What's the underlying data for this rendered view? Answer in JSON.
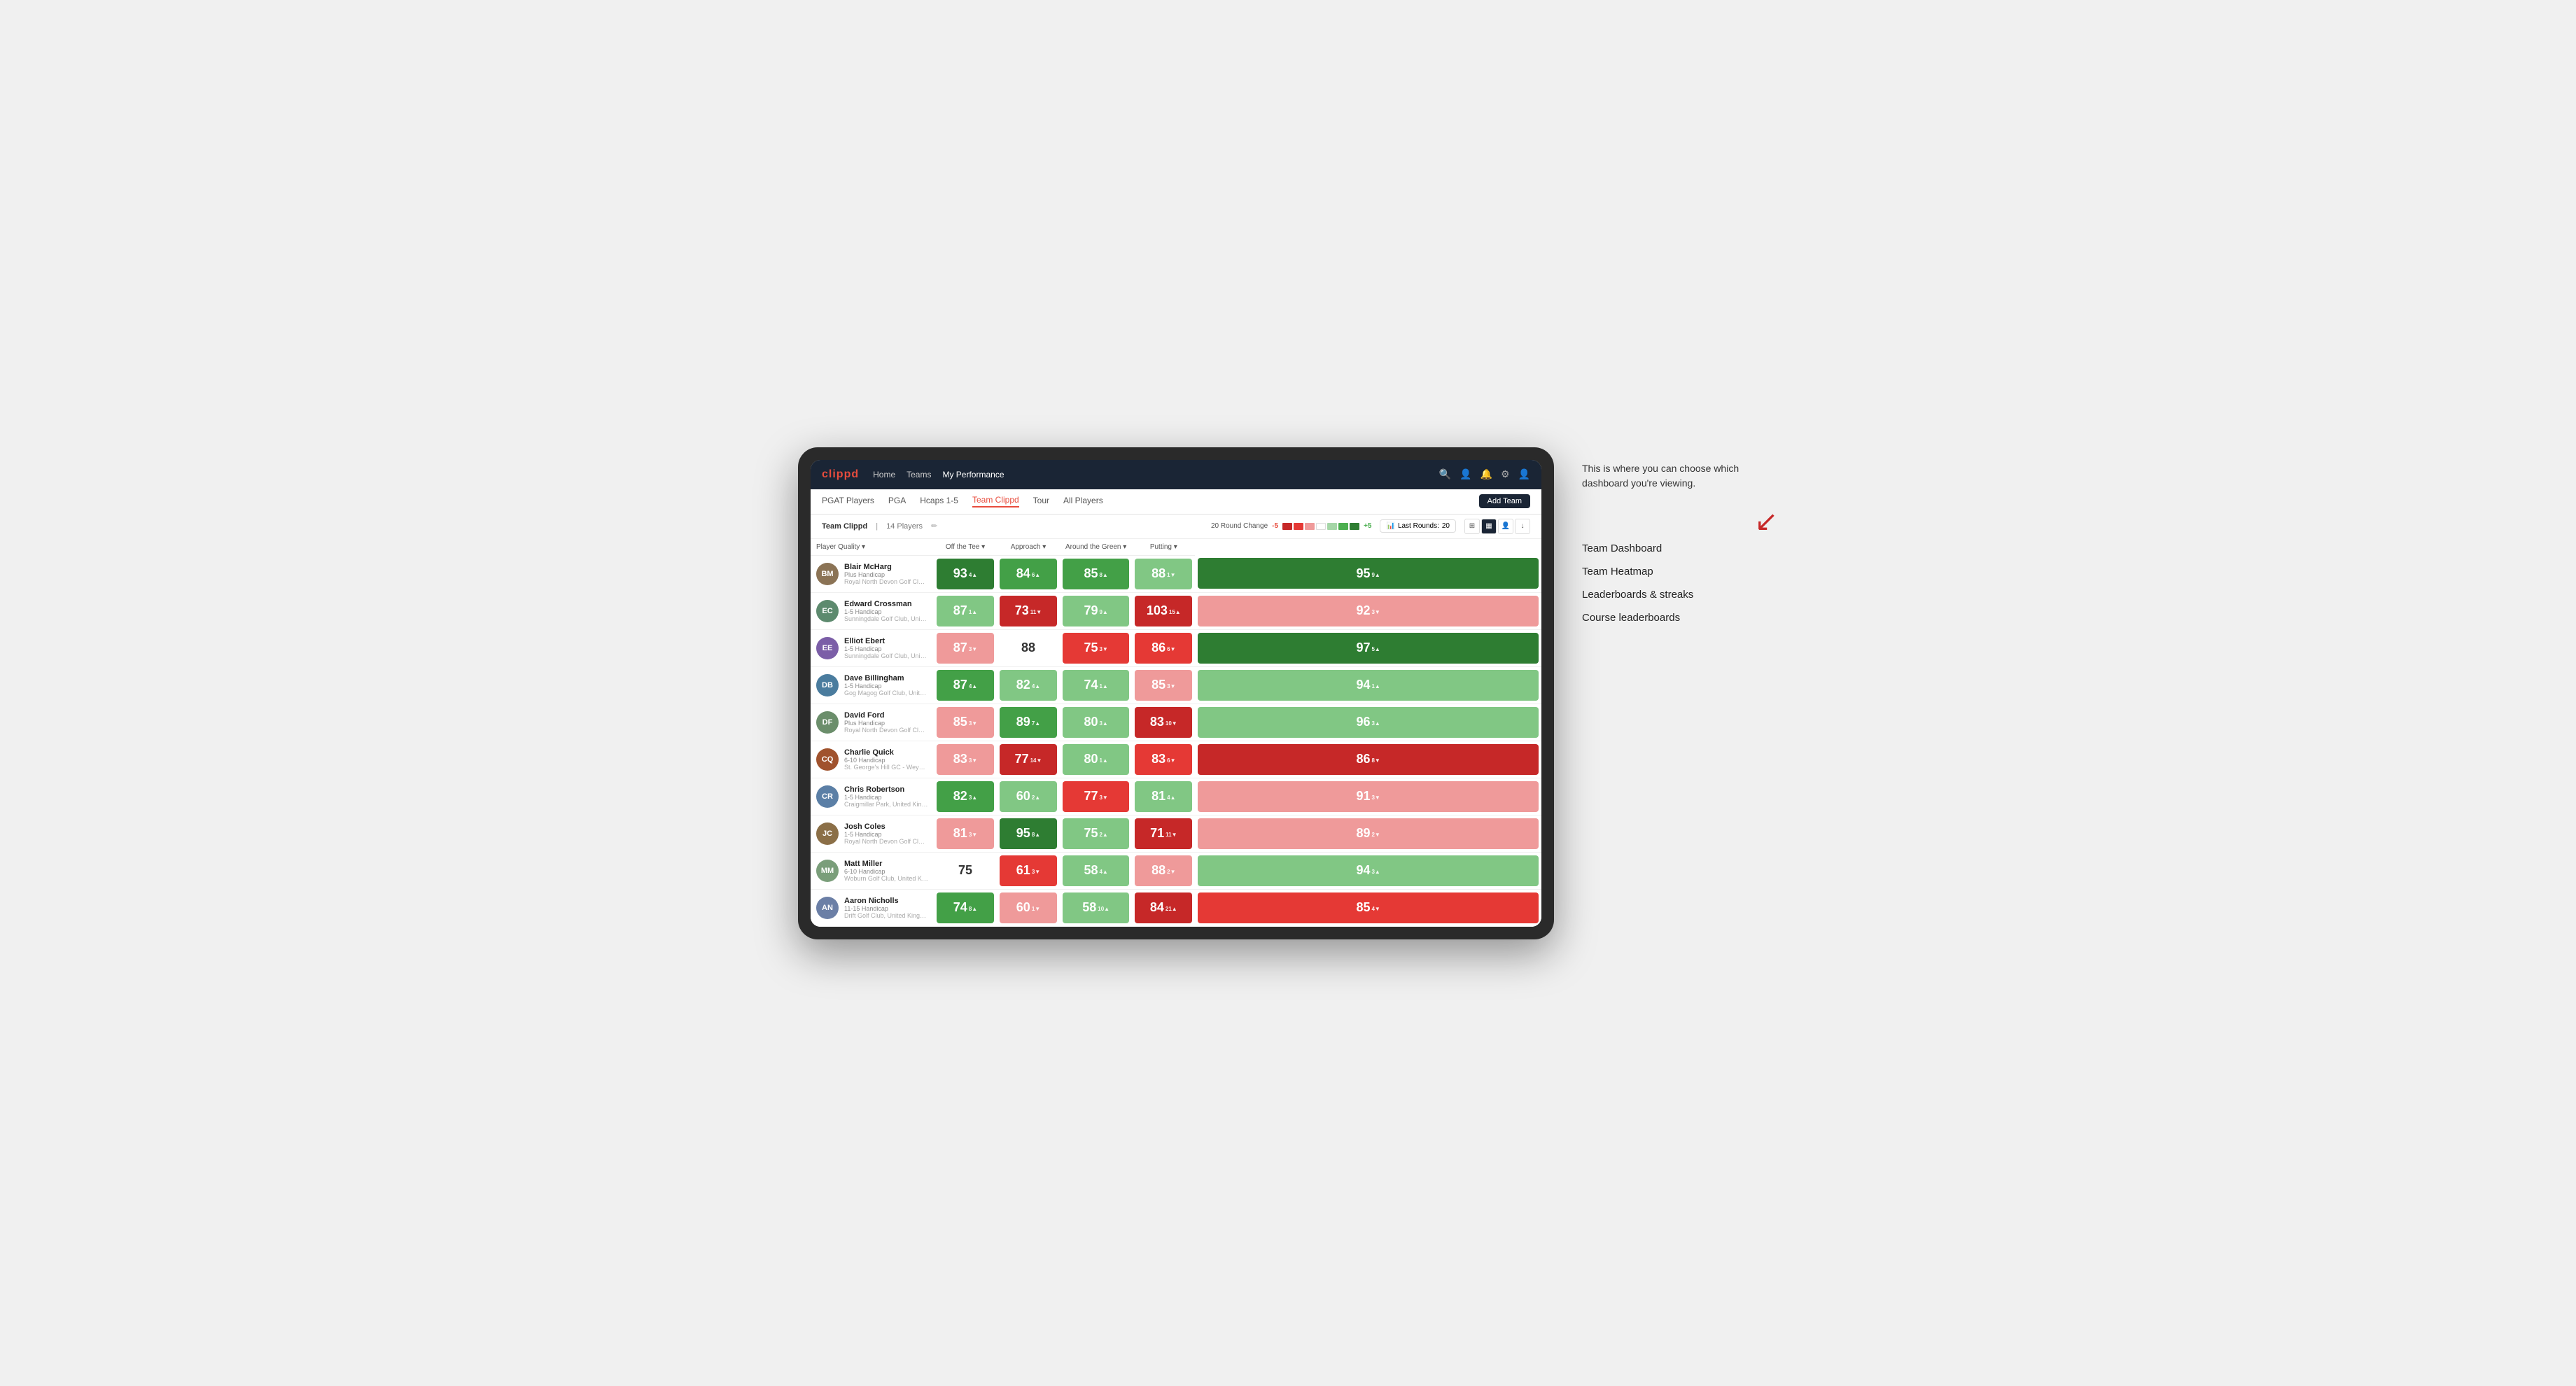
{
  "annotation": {
    "intro": "This is where you can choose which dashboard you're viewing.",
    "items": [
      "Team Dashboard",
      "Team Heatmap",
      "Leaderboards & streaks",
      "Course leaderboards"
    ]
  },
  "nav": {
    "logo": "clippd",
    "links": [
      {
        "label": "Home",
        "active": false
      },
      {
        "label": "Teams",
        "active": false
      },
      {
        "label": "My Performance",
        "active": true
      }
    ]
  },
  "sub_nav": {
    "links": [
      {
        "label": "PGAT Players",
        "active": false
      },
      {
        "label": "PGA",
        "active": false
      },
      {
        "label": "Hcaps 1-5",
        "active": false
      },
      {
        "label": "Team Clippd",
        "active": true
      },
      {
        "label": "Tour",
        "active": false
      },
      {
        "label": "All Players",
        "active": false
      }
    ],
    "add_team": "Add Team"
  },
  "team_bar": {
    "name": "Team Clippd",
    "count": "14 Players",
    "round_change_label": "20 Round Change",
    "minus_label": "-5",
    "plus_label": "+5",
    "last_rounds_label": "Last Rounds:",
    "last_rounds_value": "20"
  },
  "table": {
    "columns": [
      {
        "label": "Player Quality ▾",
        "key": "player_quality"
      },
      {
        "label": "Off the Tee ▾",
        "key": "off_tee"
      },
      {
        "label": "Approach ▾",
        "key": "approach"
      },
      {
        "label": "Around the Green ▾",
        "key": "around_green"
      },
      {
        "label": "Putting ▾",
        "key": "putting"
      }
    ],
    "rows": [
      {
        "name": "Blair McHarg",
        "handicap": "Plus Handicap",
        "club": "Royal North Devon Golf Club, United Kingdom",
        "initials": "BM",
        "avatar_color": "#8B7355",
        "player_quality": {
          "value": 93,
          "change": 4,
          "dir": "up",
          "color": "green-strong"
        },
        "off_tee": {
          "value": 84,
          "change": 6,
          "dir": "up",
          "color": "green-mid"
        },
        "approach": {
          "value": 85,
          "change": 8,
          "dir": "up",
          "color": "green-mid"
        },
        "around_green": {
          "value": 88,
          "change": 1,
          "dir": "down",
          "color": "green-light"
        },
        "putting": {
          "value": 95,
          "change": 9,
          "dir": "up",
          "color": "green-strong"
        }
      },
      {
        "name": "Edward Crossman",
        "handicap": "1-5 Handicap",
        "club": "Sunningdale Golf Club, United Kingdom",
        "initials": "EC",
        "avatar_color": "#5D8A6E",
        "player_quality": {
          "value": 87,
          "change": 1,
          "dir": "up",
          "color": "green-light"
        },
        "off_tee": {
          "value": 73,
          "change": 11,
          "dir": "down",
          "color": "red-strong"
        },
        "approach": {
          "value": 79,
          "change": 9,
          "dir": "up",
          "color": "green-light"
        },
        "around_green": {
          "value": 103,
          "change": 15,
          "dir": "up",
          "color": "red-strong"
        },
        "putting": {
          "value": 92,
          "change": 3,
          "dir": "down",
          "color": "red-light"
        }
      },
      {
        "name": "Elliot Ebert",
        "handicap": "1-5 Handicap",
        "club": "Sunningdale Golf Club, United Kingdom",
        "initials": "EE",
        "avatar_color": "#7B5EA7",
        "player_quality": {
          "value": 87,
          "change": 3,
          "dir": "down",
          "color": "red-light"
        },
        "off_tee": {
          "value": 88,
          "change": 0,
          "dir": "none",
          "color": "white"
        },
        "approach": {
          "value": 75,
          "change": 3,
          "dir": "down",
          "color": "red-mid"
        },
        "around_green": {
          "value": 86,
          "change": 6,
          "dir": "down",
          "color": "red-mid"
        },
        "putting": {
          "value": 97,
          "change": 5,
          "dir": "up",
          "color": "green-strong"
        }
      },
      {
        "name": "Dave Billingham",
        "handicap": "1-5 Handicap",
        "club": "Gog Magog Golf Club, United Kingdom",
        "initials": "DB",
        "avatar_color": "#4A7C9E",
        "player_quality": {
          "value": 87,
          "change": 4,
          "dir": "up",
          "color": "green-mid"
        },
        "off_tee": {
          "value": 82,
          "change": 4,
          "dir": "up",
          "color": "green-light"
        },
        "approach": {
          "value": 74,
          "change": 1,
          "dir": "up",
          "color": "green-light"
        },
        "around_green": {
          "value": 85,
          "change": 3,
          "dir": "down",
          "color": "red-light"
        },
        "putting": {
          "value": 94,
          "change": 1,
          "dir": "up",
          "color": "green-light"
        }
      },
      {
        "name": "David Ford",
        "handicap": "Plus Handicap",
        "club": "Royal North Devon Golf Club, United Kingdom",
        "initials": "DF",
        "avatar_color": "#6B8E6B",
        "player_quality": {
          "value": 85,
          "change": 3,
          "dir": "down",
          "color": "red-light"
        },
        "off_tee": {
          "value": 89,
          "change": 7,
          "dir": "up",
          "color": "green-mid"
        },
        "approach": {
          "value": 80,
          "change": 3,
          "dir": "up",
          "color": "green-light"
        },
        "around_green": {
          "value": 83,
          "change": 10,
          "dir": "down",
          "color": "red-strong"
        },
        "putting": {
          "value": 96,
          "change": 3,
          "dir": "up",
          "color": "green-light"
        }
      },
      {
        "name": "Charlie Quick",
        "handicap": "6-10 Handicap",
        "club": "St. George's Hill GC - Weybridge - Surrey, Uni...",
        "initials": "CQ",
        "avatar_color": "#A0522D",
        "player_quality": {
          "value": 83,
          "change": 3,
          "dir": "down",
          "color": "red-light"
        },
        "off_tee": {
          "value": 77,
          "change": 14,
          "dir": "down",
          "color": "red-strong"
        },
        "approach": {
          "value": 80,
          "change": 1,
          "dir": "up",
          "color": "green-light"
        },
        "around_green": {
          "value": 83,
          "change": 6,
          "dir": "down",
          "color": "red-mid"
        },
        "putting": {
          "value": 86,
          "change": 8,
          "dir": "down",
          "color": "red-strong"
        }
      },
      {
        "name": "Chris Robertson",
        "handicap": "1-5 Handicap",
        "club": "Craigmillar Park, United Kingdom",
        "initials": "CR",
        "avatar_color": "#5B7FA6",
        "player_quality": {
          "value": 82,
          "change": 3,
          "dir": "up",
          "color": "green-mid"
        },
        "off_tee": {
          "value": 60,
          "change": 2,
          "dir": "up",
          "color": "green-light"
        },
        "approach": {
          "value": 77,
          "change": 3,
          "dir": "down",
          "color": "red-mid"
        },
        "around_green": {
          "value": 81,
          "change": 4,
          "dir": "up",
          "color": "green-light"
        },
        "putting": {
          "value": 91,
          "change": 3,
          "dir": "down",
          "color": "red-light"
        }
      },
      {
        "name": "Josh Coles",
        "handicap": "1-5 Handicap",
        "club": "Royal North Devon Golf Club, United Kingdom",
        "initials": "JC",
        "avatar_color": "#8B6F47",
        "player_quality": {
          "value": 81,
          "change": 3,
          "dir": "down",
          "color": "red-light"
        },
        "off_tee": {
          "value": 95,
          "change": 8,
          "dir": "up",
          "color": "green-strong"
        },
        "approach": {
          "value": 75,
          "change": 2,
          "dir": "up",
          "color": "green-light"
        },
        "around_green": {
          "value": 71,
          "change": 11,
          "dir": "down",
          "color": "red-strong"
        },
        "putting": {
          "value": 89,
          "change": 2,
          "dir": "down",
          "color": "red-light"
        }
      },
      {
        "name": "Matt Miller",
        "handicap": "6-10 Handicap",
        "club": "Woburn Golf Club, United Kingdom",
        "initials": "MM",
        "avatar_color": "#7A9E7A",
        "player_quality": {
          "value": 75,
          "change": 0,
          "dir": "none",
          "color": "white"
        },
        "off_tee": {
          "value": 61,
          "change": 3,
          "dir": "down",
          "color": "red-mid"
        },
        "approach": {
          "value": 58,
          "change": 4,
          "dir": "up",
          "color": "green-light"
        },
        "around_green": {
          "value": 88,
          "change": 2,
          "dir": "down",
          "color": "red-light"
        },
        "putting": {
          "value": 94,
          "change": 3,
          "dir": "up",
          "color": "green-light"
        }
      },
      {
        "name": "Aaron Nicholls",
        "handicap": "11-15 Handicap",
        "club": "Drift Golf Club, United Kingdom",
        "initials": "AN",
        "avatar_color": "#6B7FA6",
        "player_quality": {
          "value": 74,
          "change": 8,
          "dir": "up",
          "color": "green-mid"
        },
        "off_tee": {
          "value": 60,
          "change": 1,
          "dir": "down",
          "color": "red-light"
        },
        "approach": {
          "value": 58,
          "change": 10,
          "dir": "up",
          "color": "green-light"
        },
        "around_green": {
          "value": 84,
          "change": 21,
          "dir": "up",
          "color": "red-strong"
        },
        "putting": {
          "value": 85,
          "change": 4,
          "dir": "down",
          "color": "red-mid"
        }
      }
    ]
  }
}
